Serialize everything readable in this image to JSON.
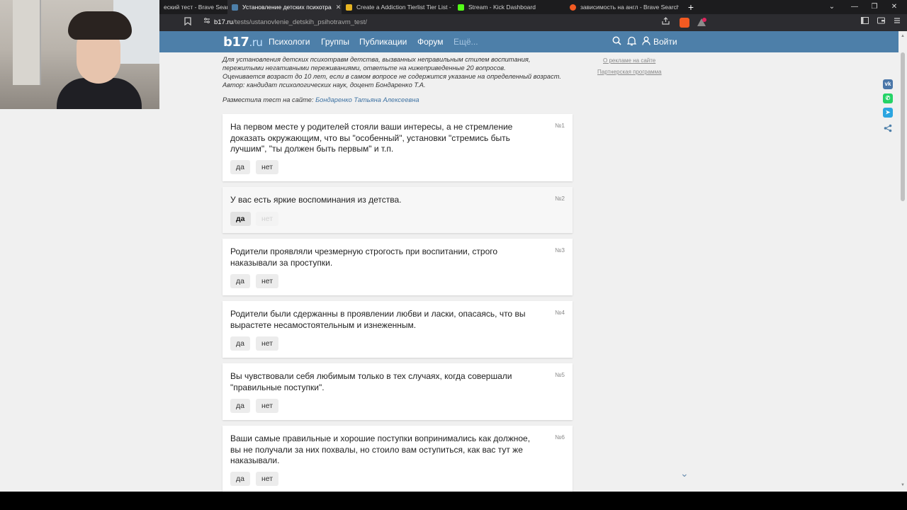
{
  "browser": {
    "tabs": [
      {
        "label": "еский тест - Brave Search",
        "favicon_color": "#f25a22",
        "active": false
      },
      {
        "label": "Установление детских психотра",
        "favicon_color": "#4d7fa9",
        "active": true,
        "close": "✕"
      },
      {
        "label": "Create a Addiction Tierlist Tier List - T",
        "favicon_color": "#e6b422",
        "active": false
      },
      {
        "label": "Stream - Kick Dashboard",
        "favicon_color": "#53fc18",
        "active": false
      },
      {
        "label": "зависимость на англ - Brave Search",
        "favicon_color": "#f25a22",
        "active": false
      }
    ],
    "newtab_label": "+",
    "window_controls": [
      "⌄",
      "—",
      "❐",
      "✕"
    ],
    "url_host": "b17.ru",
    "url_path": "/tests/ustanovlenie_detskih_psihotravm_test/",
    "shield_badge_count": ""
  },
  "site": {
    "logo_main": "b17",
    "logo_suffix": ".ru",
    "nav": [
      "Психологи",
      "Группы",
      "Публикации",
      "Форум",
      "Ещё..."
    ],
    "login_label": "Войти"
  },
  "intro_lines": [
    "Для установления детских психотравм детства, вызванных неправильным стилем воспитания,",
    "пережитыми негативными переживаниями, ответьте на нижеприведенные 20 вопросов.",
    "Оценивается возраст до 10 лет, если в самом вопросе не содержится указание на определенный возраст.",
    "Автор: кандидат психологических наук, доцент Бондаренко Т.А."
  ],
  "author_prefix": "Разместила тест на сайте: ",
  "author_name": "Бондаренко Татьяна Алексеевна",
  "sidebar_links": [
    "О рекламе на сайте",
    "Партнерская программа"
  ],
  "questions": [
    {
      "num": "№1",
      "text": "На первом месте у родителей стояли ваши интересы, а не стремление доказать окружающим, что вы \"особенный\", установки \"стремись быть лучшим\", \"ты должен быть первым\" и т.п.",
      "yes": "да",
      "no": "нет",
      "answer": "none"
    },
    {
      "num": "№2",
      "text": "У вас есть яркие воспоминания из детства.",
      "yes": "да",
      "no": "нет",
      "answer": "yes"
    },
    {
      "num": "№3",
      "text": "Родители проявляли чрезмерную строгость при воспитании, строго наказывали за проступки.",
      "yes": "да",
      "no": "нет",
      "answer": "none"
    },
    {
      "num": "№4",
      "text": "Родители были сдержанны в проявлении любви и ласки, опасаясь, что вы вырастете несамостоятельным и изнеженным.",
      "yes": "да",
      "no": "нет",
      "answer": "none"
    },
    {
      "num": "№5",
      "text": "Вы чувствовали себя любимым только в тех случаях, когда совершали \"правильные поступки\".",
      "yes": "да",
      "no": "нет",
      "answer": "none"
    },
    {
      "num": "№6",
      "text": "Ваши самые правильные и хорошие поступки вопринимались как должное, вы не получали за них похвалы, но стоило вам оступиться, как вас тут же наказывали.",
      "yes": "да",
      "no": "нет",
      "answer": "none"
    }
  ],
  "share_icons": [
    {
      "name": "vk-icon",
      "glyph": "vk",
      "color": "#4a76a8"
    },
    {
      "name": "whatsapp-icon",
      "glyph": "✆",
      "color": "#25d366"
    },
    {
      "name": "telegram-icon",
      "glyph": "➤",
      "color": "#2ca5e0"
    },
    {
      "name": "share-icon",
      "glyph": "⋖",
      "color": "#4d7fa9"
    }
  ],
  "scroll_chevron": "⌄"
}
